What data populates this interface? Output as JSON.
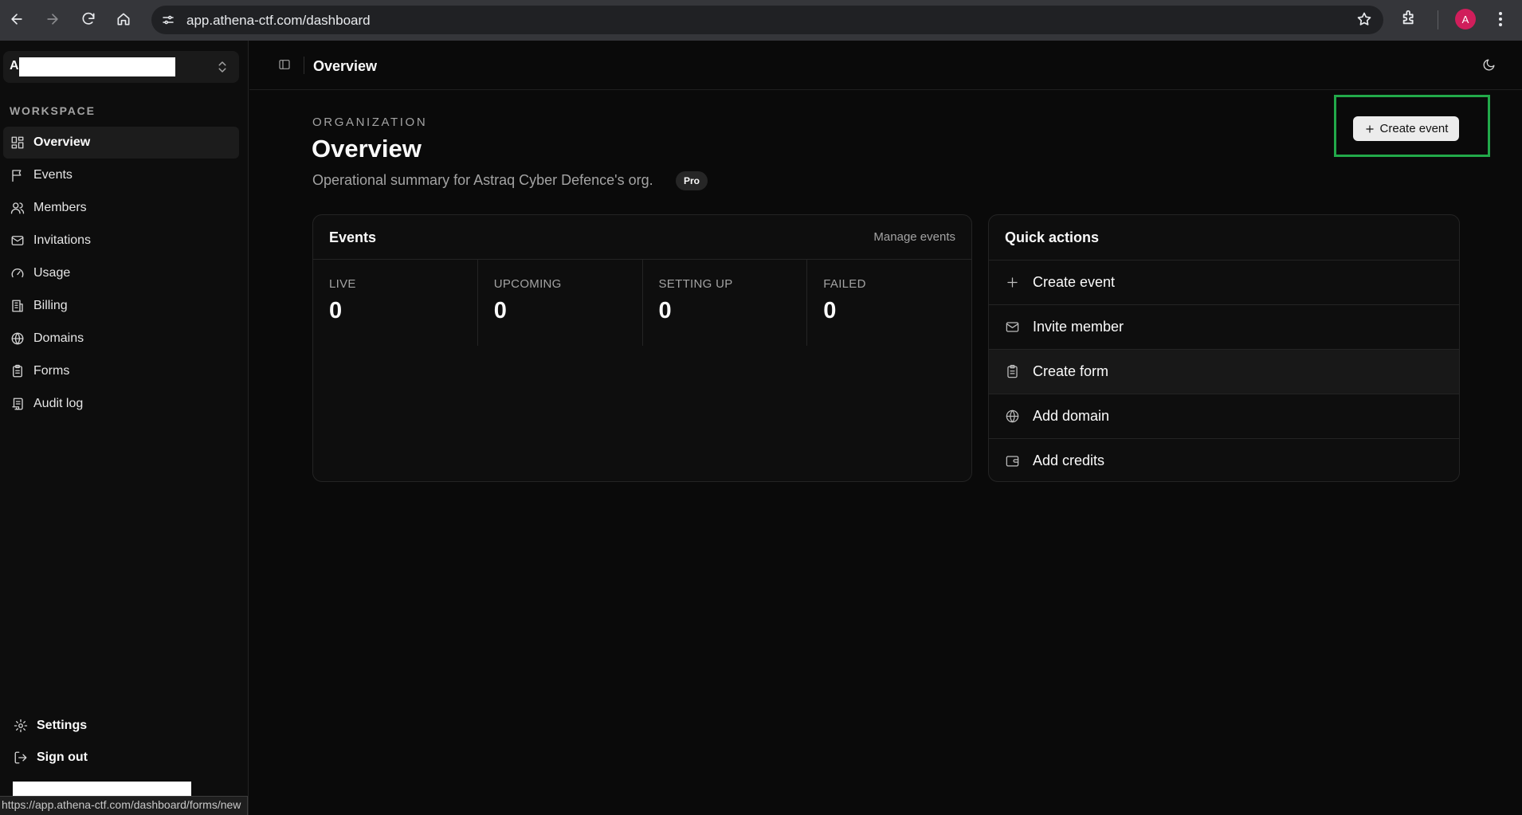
{
  "browser": {
    "url": "app.athena-ctf.com/dashboard",
    "profile_initial": "A"
  },
  "sidebar": {
    "org_initial": "A",
    "section_label": "WORKSPACE",
    "items": [
      {
        "label": "Overview",
        "icon": "layout-dashboard-icon",
        "active": true
      },
      {
        "label": "Events",
        "icon": "flag-icon",
        "active": false
      },
      {
        "label": "Members",
        "icon": "users-icon",
        "active": false
      },
      {
        "label": "Invitations",
        "icon": "mail-icon",
        "active": false
      },
      {
        "label": "Usage",
        "icon": "gauge-icon",
        "active": false
      },
      {
        "label": "Billing",
        "icon": "building-icon",
        "active": false
      },
      {
        "label": "Domains",
        "icon": "globe-icon",
        "active": false
      },
      {
        "label": "Forms",
        "icon": "clipboard-icon",
        "active": false
      },
      {
        "label": "Audit log",
        "icon": "scroll-icon",
        "active": false
      }
    ],
    "settings_label": "Settings",
    "signout_label": "Sign out"
  },
  "status_bar": {
    "link_url": "https://app.athena-ctf.com/dashboard/forms/new"
  },
  "header": {
    "title": "Overview"
  },
  "main": {
    "eyebrow": "ORGANIZATION",
    "title": "Overview",
    "subtitle": "Operational summary for Astraq Cyber Defence's org.",
    "plan_badge": "Pro",
    "create_event_label": "Create event"
  },
  "events_card": {
    "title": "Events",
    "link": "Manage events",
    "stats": [
      {
        "label": "LIVE",
        "value": "0"
      },
      {
        "label": "UPCOMING",
        "value": "0"
      },
      {
        "label": "SETTING UP",
        "value": "0"
      },
      {
        "label": "FAILED",
        "value": "0"
      }
    ]
  },
  "quick_actions": {
    "title": "Quick actions",
    "items": [
      {
        "label": "Create event",
        "icon": "plus-icon"
      },
      {
        "label": "Invite member",
        "icon": "mail-icon"
      },
      {
        "label": "Create form",
        "icon": "clipboard-icon"
      },
      {
        "label": "Add domain",
        "icon": "globe-icon"
      },
      {
        "label": "Add credits",
        "icon": "wallet-icon"
      }
    ]
  },
  "colors": {
    "highlight": "#22a94a",
    "profile": "#d01e5b"
  }
}
